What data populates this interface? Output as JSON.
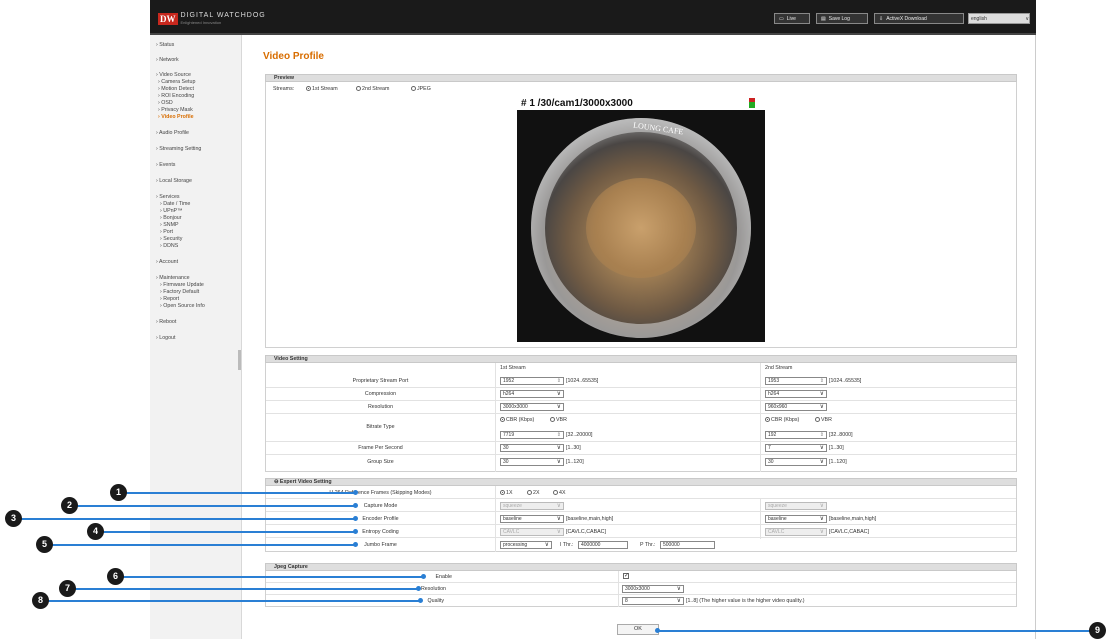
{
  "app": {
    "logo_mark": "DW",
    "logo_text": "DIGITAL WATCHDOG",
    "logo_sub": "Enlightened Innovation"
  },
  "topbar": {
    "live": "Live",
    "save_log": "Save Log",
    "activex": "ActiveX Download",
    "language": "english"
  },
  "sidebar": {
    "items": [
      "Status",
      "Network",
      "Video Source",
      "Camera Setup",
      "Motion Detect",
      "ROI Encoding",
      "OSD",
      "Privacy Mask",
      "Video Profile",
      "Audio Profile",
      "Streaming Setting",
      "Events",
      "Local Storage",
      "Services",
      "Date / Time",
      "UPnP™",
      "Bonjour",
      "SNMP",
      "Port",
      "Security",
      "DDNS",
      "Account",
      "Maintenance",
      "Firmware Update",
      "Factory Default",
      "Report",
      "Open Source Info",
      "Reboot",
      "Logout"
    ]
  },
  "page": {
    "title": "Video Profile"
  },
  "preview": {
    "header": "Preview",
    "streams_label": "Streams:",
    "options": [
      "1st Stream",
      "2nd Stream",
      "JPEG"
    ],
    "stream_title": "# 1  /30/cam1/3000x3000",
    "overlay_text": "LOUNG CAFE"
  },
  "video_setting": {
    "header": "Video Setting",
    "col1": "1st Stream",
    "col2": "2nd Stream",
    "rows": {
      "port": {
        "label": "Proprietary Stream Port",
        "v1": "1952",
        "r1": "[1024..65535]",
        "v2": "1953",
        "r2": "[1024..65535]"
      },
      "compression": {
        "label": "Compression",
        "v1": "h264",
        "v2": "h264"
      },
      "resolution": {
        "label": "Resolution",
        "v1": "3000x3000",
        "v2": "960x960"
      },
      "bitrate": {
        "label": "Bitrate Type",
        "cbr": "CBR (Kbps)",
        "vbr": "VBR",
        "v1": "7719",
        "r1": "[32..20000]",
        "v2": "192",
        "r2": "[32..8000]"
      },
      "fps": {
        "label": "Frame Per Second",
        "v1": "30",
        "r1": "[1..30]",
        "v2": "7",
        "r2": "[1..30]"
      },
      "gop": {
        "label": "Group Size",
        "v1": "30",
        "r1": "[1..120]",
        "v2": "30",
        "r2": "[1..120]"
      }
    }
  },
  "expert": {
    "header": "Expert Video Setting",
    "ref_label": "H.264 Reference Frames (Skipping Modes)",
    "ref_options": [
      "1X",
      "2X",
      "4X"
    ],
    "capture_label": "Capture Mode",
    "capture_v1": "squeeze",
    "capture_v2": "squeeze",
    "profile_label": "Encoder Profile",
    "profile_v1": "baseline",
    "profile_r1": "[baseline,main,high]",
    "profile_v2": "baseline",
    "profile_r2": "[baseline,main,high]",
    "entropy_label": "Entropy Coding",
    "entropy_v1": "CAVLC",
    "entropy_r1": "[CAVLC,CABAC]",
    "entropy_v2": "CAVLC",
    "entropy_r2": "[CAVLC,CABAC]",
    "jumbo_label": "Jumbo Frame",
    "jumbo_v": "processing",
    "ithr_label": "I Thr.:",
    "ithr_v": "4000000",
    "pthr_label": "P Thr.:",
    "pthr_v": "500000"
  },
  "jpeg": {
    "header": "Jpeg Capture",
    "enable_label": "Enable",
    "enable_mark": "✓",
    "res_label": "Resolution",
    "res_v": "3000x3000",
    "quality_label": "Quality",
    "quality_v": "8",
    "quality_note": "[1..8] (The higher value is the higher video quality.)"
  },
  "ok_label": "OK",
  "callouts": [
    "1",
    "2",
    "3",
    "4",
    "5",
    "6",
    "7",
    "8",
    "9"
  ],
  "colors": {
    "accent": "#d86d00",
    "callout_line": "#2a7fd4",
    "callout": "#1a1a1a"
  }
}
